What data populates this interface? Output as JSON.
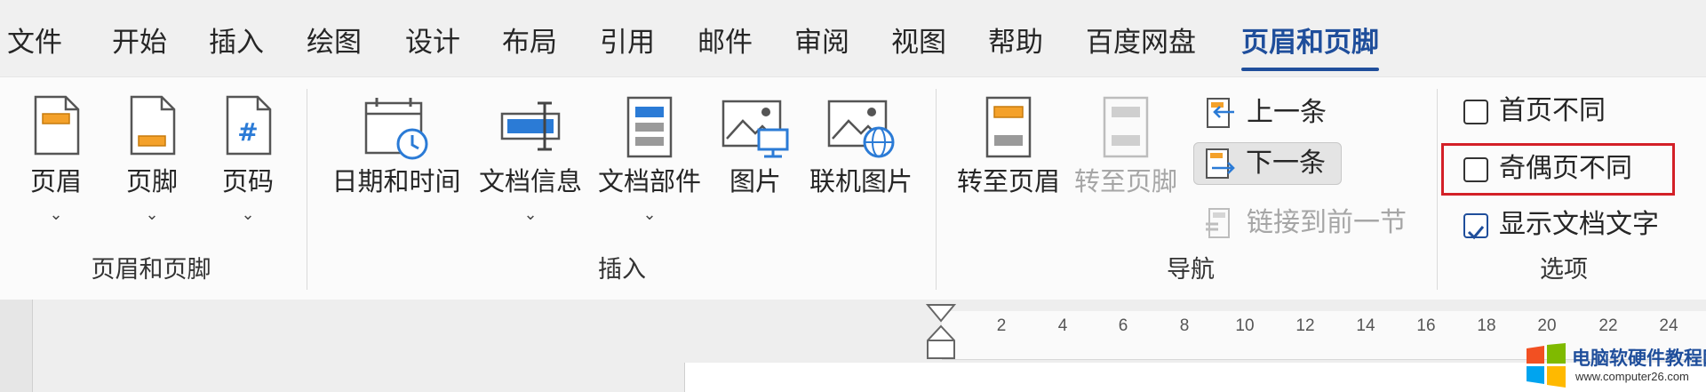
{
  "tabs": [
    {
      "label": "文件",
      "active": false
    },
    {
      "label": "开始",
      "active": false
    },
    {
      "label": "插入",
      "active": false
    },
    {
      "label": "绘图",
      "active": false
    },
    {
      "label": "设计",
      "active": false
    },
    {
      "label": "布局",
      "active": false
    },
    {
      "label": "引用",
      "active": false
    },
    {
      "label": "邮件",
      "active": false
    },
    {
      "label": "审阅",
      "active": false
    },
    {
      "label": "视图",
      "active": false
    },
    {
      "label": "帮助",
      "active": false
    },
    {
      "label": "百度网盘",
      "active": false
    },
    {
      "label": "页眉和页脚",
      "active": true
    }
  ],
  "groups": {
    "header_footer": {
      "label": "页眉和页脚",
      "buttons": [
        {
          "label": "页眉",
          "icon": "header-page-icon",
          "dropdown": true
        },
        {
          "label": "页脚",
          "icon": "footer-page-icon",
          "dropdown": true
        },
        {
          "label": "页码",
          "icon": "page-number-icon",
          "dropdown": true
        }
      ]
    },
    "insert": {
      "label": "插入",
      "buttons": [
        {
          "label": "日期和时间",
          "icon": "calendar-clock-icon",
          "dropdown": false
        },
        {
          "label": "文档信息",
          "icon": "document-info-icon",
          "dropdown": true
        },
        {
          "label": "文档部件",
          "icon": "quick-parts-icon",
          "dropdown": true
        },
        {
          "label": "图片",
          "icon": "picture-icon",
          "dropdown": false
        },
        {
          "label": "联机图片",
          "icon": "online-picture-icon",
          "dropdown": false
        }
      ]
    },
    "navigation": {
      "label": "导航",
      "buttons": [
        {
          "label": "转至页眉",
          "icon": "goto-header-icon",
          "enabled": true
        },
        {
          "label": "转至页脚",
          "icon": "goto-footer-icon",
          "enabled": false
        }
      ],
      "small": [
        {
          "label": "上一条",
          "icon": "previous-icon",
          "enabled": true,
          "selected": false
        },
        {
          "label": "下一条",
          "icon": "next-icon",
          "enabled": true,
          "selected": true
        },
        {
          "label": "链接到前一节",
          "icon": "link-previous-icon",
          "enabled": false,
          "selected": false
        }
      ]
    },
    "options": {
      "label": "选项",
      "checkboxes": [
        {
          "label": "首页不同",
          "checked": false
        },
        {
          "label": "奇偶页不同",
          "checked": false,
          "highlighted": true
        },
        {
          "label": "显示文档文字",
          "checked": true
        }
      ]
    }
  },
  "ruler": {
    "ticks": [
      "2",
      "4",
      "6",
      "8",
      "10",
      "12",
      "14",
      "16",
      "18",
      "20",
      "22",
      "24"
    ]
  },
  "watermark": {
    "title": "电脑软硬件教程网",
    "url": "www.computer26.com"
  },
  "colors": {
    "accent": "#1f4e9b",
    "highlight": "#d32027",
    "icon_orange": "#f4a12a",
    "icon_blue": "#2b7bd6"
  }
}
